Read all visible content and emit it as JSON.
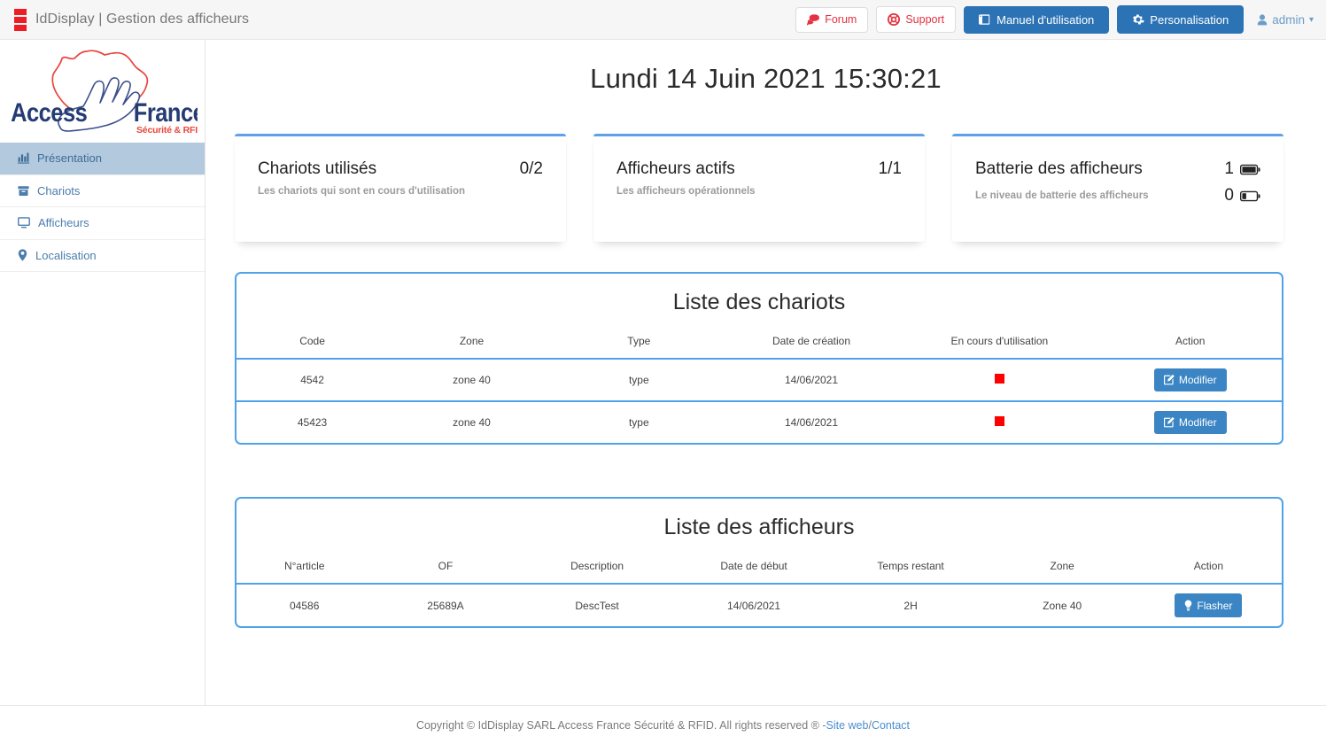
{
  "navbar": {
    "brand_title": "IdDisplay | Gestion des afficheurs",
    "logo_icon": "three-red-squares-icon",
    "buttons": [
      {
        "label": "Forum",
        "icon": "comments-icon",
        "style": "outline-red"
      },
      {
        "label": "Support",
        "icon": "life-ring-icon",
        "style": "outline-red"
      },
      {
        "label": "Manuel d'utilisation",
        "icon": "book-icon",
        "style": "primary"
      },
      {
        "label": "Personalisation",
        "icon": "gear-icon",
        "style": "primary"
      }
    ],
    "user": {
      "label": "admin",
      "caret": "▾",
      "icon": "user-icon"
    }
  },
  "sidebar": {
    "logo": {
      "word_left": "Access",
      "word_right": "France",
      "tagline": "Sécurité & RFID",
      "icon": "france-map-hand-logo"
    },
    "items": [
      {
        "label": "Présentation",
        "icon": "chart-bar-icon",
        "active": true
      },
      {
        "label": "Chariots",
        "icon": "archive-box-icon",
        "active": false
      },
      {
        "label": "Afficheurs",
        "icon": "desktop-monitor-icon",
        "active": false
      },
      {
        "label": "Localisation",
        "icon": "map-marker-icon",
        "active": false
      }
    ]
  },
  "main": {
    "page_title": "Lundi 14 Juin 2021 15:30:21",
    "cards": [
      {
        "title": "Chariots utilisés",
        "value": "0/2",
        "subtitle": "Les chariots qui sont en cours d'utilisation"
      },
      {
        "title": "Afficheurs actifs",
        "value": "1/1",
        "subtitle": "Les afficheurs opérationnels"
      },
      {
        "title": "Batterie des afficheurs",
        "value": "1",
        "value_icon": "battery-full-icon",
        "subtitle": "Le niveau de batterie des afficheurs",
        "sub_value": "0",
        "sub_value_icon": "battery-low-icon"
      }
    ],
    "chariots_table": {
      "title": "Liste des chariots",
      "columns": [
        "Code",
        "Zone",
        "Type",
        "Date de création",
        "En cours d'utilisation",
        "Action"
      ],
      "rows": [
        {
          "code": "4542",
          "zone": "zone 40",
          "type": "type",
          "date": "14/06/2021",
          "status": "red-square-indicator",
          "action_label": "Modifier",
          "action_icon": "edit-pencil-square-icon"
        },
        {
          "code": "45423",
          "zone": "zone 40",
          "type": "type",
          "date": "14/06/2021",
          "status": "red-square-indicator",
          "action_label": "Modifier",
          "action_icon": "edit-pencil-square-icon"
        }
      ]
    },
    "afficheurs_table": {
      "title": "Liste des afficheurs",
      "columns": [
        "N°article",
        "OF",
        "Description",
        "Date de début",
        "Temps restant",
        "Zone",
        "Action"
      ],
      "rows": [
        {
          "article": "04586",
          "of": "25689A",
          "description": "DescTest",
          "date_debut": "14/06/2021",
          "temps_restant": "2H",
          "zone": "Zone 40",
          "action_label": "Flasher",
          "action_icon": "lightbulb-icon"
        }
      ]
    }
  },
  "footer": {
    "text": "Copyright © IdDisplay SARL Access France Sécurité & RFID. All rights reserved ® - ",
    "link_site": "Site web",
    "separator": " / ",
    "link_contact": "Contact"
  },
  "colors": {
    "primary_blue": "#2c73b5",
    "accent_blue": "#4ea2ea",
    "card_border": "#5fa0e8",
    "red": "#ee1c25",
    "status_red": "#ff0000",
    "sidebar_active": "#b3c9de",
    "link_blue": "#4a8fd0"
  }
}
